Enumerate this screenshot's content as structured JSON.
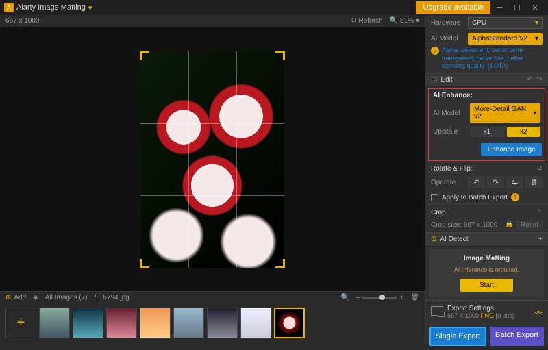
{
  "titlebar": {
    "app_name": "Aiarty Image Matting",
    "upgrade": "Upgrade available"
  },
  "canvas": {
    "dims": "667 x 1000",
    "refresh": "Refresh",
    "zoom": "51%"
  },
  "filmstrip": {
    "add": "Add",
    "all_images": "All Images (7)",
    "current": "5794.jpg"
  },
  "panel": {
    "hardware": {
      "label": "Hardware",
      "value": "CPU"
    },
    "aimodel": {
      "label": "AI Model",
      "value": "AlphaStandard V2",
      "desc": "Alpha refinement, better semi-transparent, better hair, better blending quality. (SOTA)"
    },
    "edit_head": "Edit",
    "enhance": {
      "title": "AI Enhance:",
      "model_label": "AI Model",
      "model_value": "More-Detail GAN v2",
      "upscale_label": "Upscale",
      "x1": "x1",
      "x2": "x2",
      "btn": "Enhance Image"
    },
    "rotate": {
      "title": "Rotate & Flip:",
      "operate": "Operate",
      "apply": "Apply to Batch Export"
    },
    "crop": {
      "title": "Crop",
      "size_label": "Crop size: 667 x 1000",
      "reset": "Reset"
    },
    "detect": {
      "head": "AI Detect",
      "title": "Image Matting",
      "msg": "AI Inference is required.",
      "start": "Start"
    },
    "export": {
      "title": "Export Settings",
      "dims": "667 X 1000",
      "fmt": "PNG",
      "bits": "[0 bits]",
      "single": "Single Export",
      "batch": "Batch Export"
    }
  }
}
